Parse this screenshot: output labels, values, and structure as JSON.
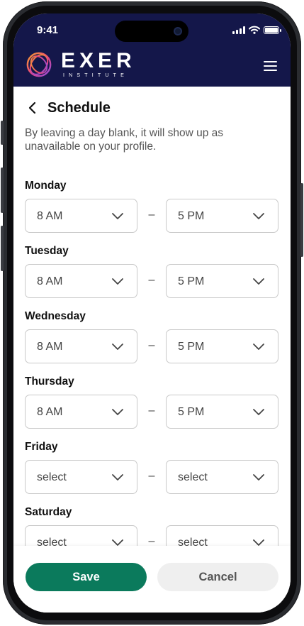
{
  "status_bar": {
    "time": "9:41"
  },
  "header": {
    "brand_name": "EXER",
    "brand_sub": "INSTITUTE",
    "menu_icon": "hamburger-menu-icon"
  },
  "page": {
    "title": "Schedule",
    "back_icon": "chevron-left-icon",
    "intro": "By leaving a day blank, it will show up as unavailable on your profile."
  },
  "separator": "–",
  "days": [
    {
      "label": "Monday",
      "start": "8 AM",
      "end": "5 PM"
    },
    {
      "label": "Tuesday",
      "start": "8 AM",
      "end": "5 PM"
    },
    {
      "label": "Wednesday",
      "start": "8 AM",
      "end": "5 PM"
    },
    {
      "label": "Thursday",
      "start": "8 AM",
      "end": "5 PM"
    },
    {
      "label": "Friday",
      "start": "select",
      "end": "select"
    },
    {
      "label": "Saturday",
      "start": "select",
      "end": "select"
    }
  ],
  "footer": {
    "save_label": "Save",
    "cancel_label": "Cancel"
  },
  "colors": {
    "header_bg": "#14174a",
    "save_bg": "#0b7a5c",
    "cancel_bg": "#efefef"
  }
}
